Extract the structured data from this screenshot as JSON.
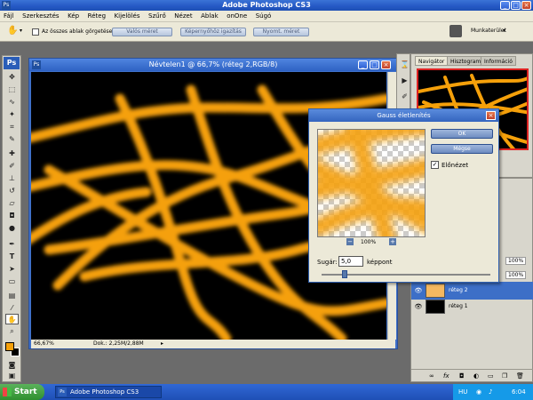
{
  "app": {
    "title": "Adobe Photoshop CS3"
  },
  "menu": [
    "Fájl",
    "Szerkesztés",
    "Kép",
    "Réteg",
    "Kijelölés",
    "Szűrő",
    "Nézet",
    "Ablak",
    "onOne",
    "Súgó"
  ],
  "options": {
    "scroll_all": "Az összes ablak görgetése",
    "btn_actual": "Valós méret",
    "btn_fit": "Képernyőhöz igazítás",
    "btn_print": "Nyomt. méret",
    "workspace": "Munkaterület"
  },
  "document": {
    "title": "Névtelen1 @ 66,7% (réteg 2,RGB/8)",
    "zoom": "66,67%",
    "doc_info": "Dok.: 2,25M/2,88M",
    "stroke_color": "#f5a00a"
  },
  "navigator": {
    "tabs": [
      "Navigátor",
      "Hisztogram",
      "Információ"
    ]
  },
  "layers": {
    "opacity": "100%",
    "fill": "100%",
    "items": [
      {
        "name": "réteg 2",
        "selected": true
      },
      {
        "name": "réteg 1",
        "selected": false
      }
    ]
  },
  "dialog": {
    "title": "Gauss életlenítés",
    "ok": "OK",
    "cancel": "Mégse",
    "preview_label": "Előnézet",
    "preview_checked": true,
    "zoom": "100%",
    "radius_label": "Sugár:",
    "radius_value": "5,0",
    "radius_unit": "képpont"
  },
  "taskbar": {
    "start": "Start",
    "task": "Adobe Photoshop CS3",
    "lang": "HU",
    "time": "6:04"
  }
}
